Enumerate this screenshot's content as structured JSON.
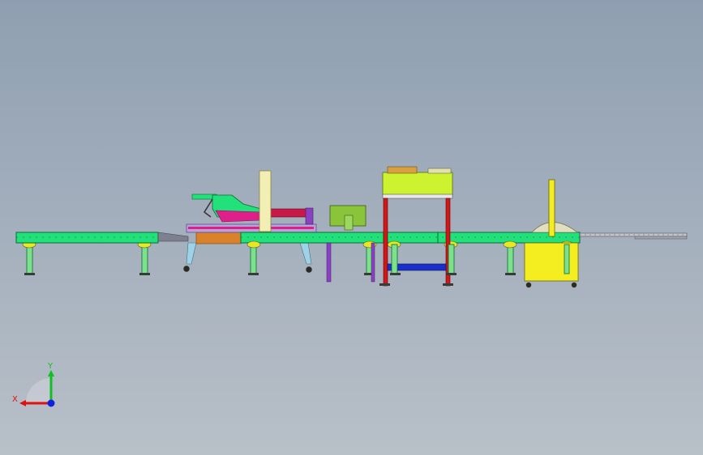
{
  "scene": {
    "kind": "cad-assembly-side-view",
    "view_background": {
      "top": "#8f9fb1",
      "bottom": "#b8c0c8"
    }
  },
  "colors": {
    "conveyor_frame": "#22e07a",
    "conveyor_edge": "#0b6b35",
    "leg": "#7de08a",
    "foot_pad": "#e8e820",
    "magenta": "#e0208a",
    "purple": "#8a40c0",
    "cream_post": "#f2eeb4",
    "orange_block": "#d9822b",
    "light_blue_frame": "#9ed2e6",
    "lime_box": "#ccf230",
    "red_frame": "#d01818",
    "blue_shelf": "#1830c8",
    "yellow_unit": "#f4ee20",
    "grey_steel": "#7c8090",
    "triad_x": "#e01010",
    "triad_y": "#10c020",
    "triad_z": "#1020e0"
  },
  "components": [
    "infeed-conveyor",
    "transfer-ramp",
    "carton-folder-station",
    "vertical-post",
    "control-box",
    "taping-head-frame",
    "main-conveyor",
    "strapping-machine",
    "outfeed-rail"
  ],
  "triad": {
    "x_label": "X",
    "y_label": "Y"
  }
}
